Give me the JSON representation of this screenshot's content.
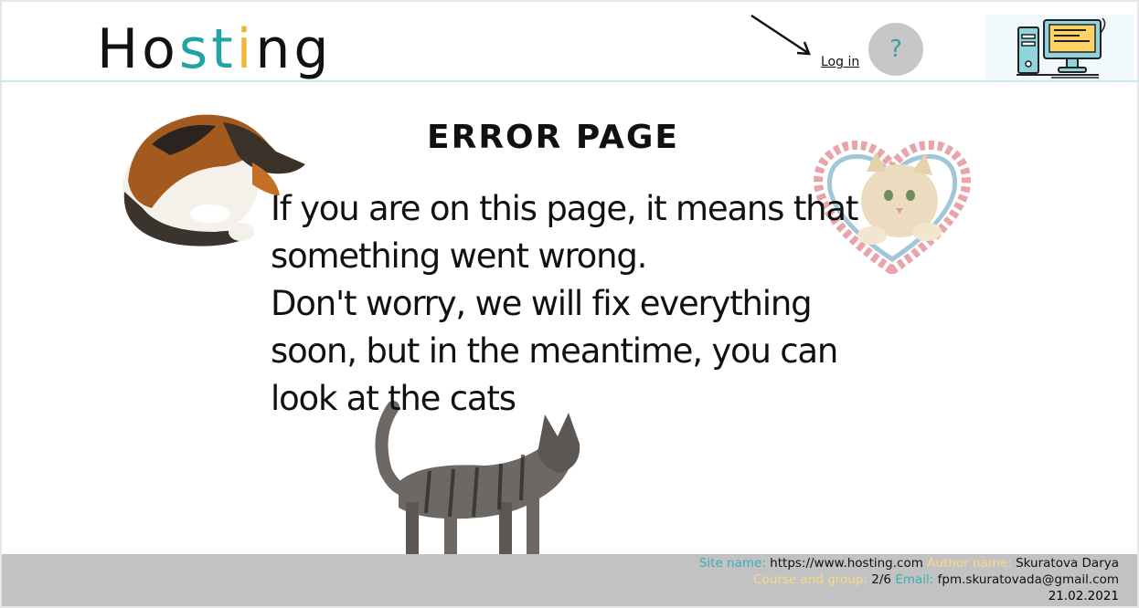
{
  "header": {
    "logo": {
      "letters": [
        "H",
        "o",
        "s",
        "t",
        "i",
        "n",
        "g"
      ]
    },
    "login_label": "Log in",
    "help_label": "?"
  },
  "main": {
    "title": "ERROR PAGE",
    "message": "If you are on this page, it means that\nsomething went wrong.\n Don't worry, we will fix everything\nsoon, but in the meantime, you can\nlook at the cats"
  },
  "footer": {
    "site_name_label": "Site name:",
    "site_name_value": "https://www.hosting.com",
    "author_label": "Author name:",
    "author_value": "Skuratova Darya",
    "course_label": "Course and group:",
    "course_value": "2/6",
    "email_label": "Email:",
    "email_value": "fpm.skuratovada@gmail.com",
    "date": "21.02.2021"
  },
  "colors": {
    "teal": "#22a4a4",
    "gold": "#f2b53c",
    "footer_bg": "#c2c2c2",
    "help_bg": "#c7c7c7"
  },
  "icons": [
    "arrow-icon",
    "computer-icon"
  ]
}
